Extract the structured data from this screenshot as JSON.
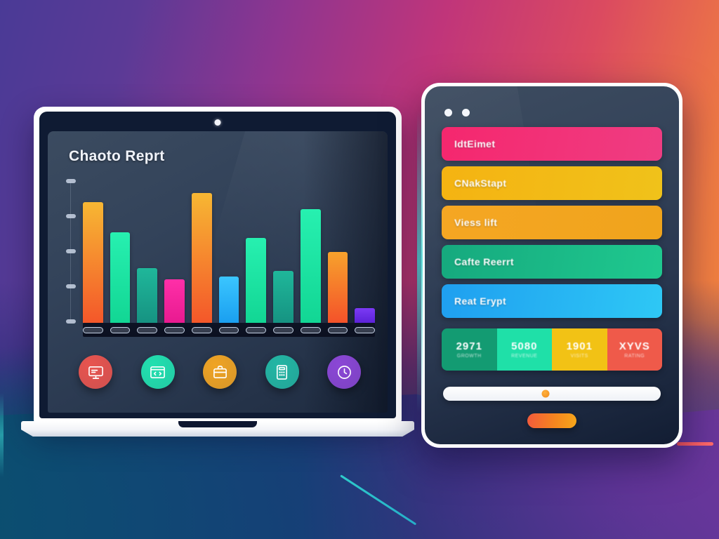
{
  "background": {
    "gradient_start": "#4a3a96",
    "gradient_mid": "#c0357a",
    "gradient_end": "#ee7a43",
    "bottom_teal": "#0b4e70",
    "accent_line": "#2fd8d2",
    "accent_dash": "#f4515a"
  },
  "laptop": {
    "screen_title": "Chaoto Reprt",
    "frame_color": "#ffffff",
    "screen_bg": "#33435a",
    "dock": [
      {
        "name": "presentation-icon",
        "color": "#e8544f",
        "glyph": "presentation"
      },
      {
        "name": "code-window-icon",
        "color": "#22e0b0",
        "glyph": "code"
      },
      {
        "name": "briefcase-icon",
        "color": "#f0a424",
        "glyph": "briefcase"
      },
      {
        "name": "calculator-icon",
        "color": "#23b6a4",
        "glyph": "calculator"
      },
      {
        "name": "clock-icon",
        "color": "#8b47d6",
        "glyph": "clock"
      }
    ]
  },
  "chart_data": {
    "type": "bar",
    "title": "Chaoto Reprt",
    "xlabel": "",
    "ylabel": "",
    "grid": false,
    "legend": "none",
    "ylim": [
      0,
      100
    ],
    "ytick_count": 5,
    "categories": [
      "",
      "",
      "",
      "",
      "",
      "",
      "",
      "",
      "",
      "",
      ""
    ],
    "values": [
      88,
      66,
      40,
      32,
      95,
      34,
      62,
      38,
      83,
      52,
      11
    ],
    "colors": [
      "#f5a623",
      "#1fe6a8",
      "#1aa98f",
      "#f0289c",
      "#f5a623",
      "#2bb6f0",
      "#1fe6a8",
      "#1aa98f",
      "#1fe6a8",
      "#f28c28",
      "#6b2ef0"
    ],
    "bar_gradients": [
      [
        "#f7b733",
        "#f4572a"
      ],
      [
        "#27f0b0",
        "#12d694"
      ],
      [
        "#1fb79a",
        "#169382"
      ],
      [
        "#ff2fa8",
        "#e81a90"
      ],
      [
        "#f7b733",
        "#f4572a"
      ],
      [
        "#3bc6ff",
        "#1a9ff0"
      ],
      [
        "#27f0b0",
        "#12d694"
      ],
      [
        "#1fb79a",
        "#169382"
      ],
      [
        "#27f0b0",
        "#12d694"
      ],
      [
        "#f7a22c",
        "#f4522a"
      ],
      [
        "#7b3af5",
        "#5c22d8"
      ]
    ]
  },
  "tablet": {
    "frame_color": "#ffffff",
    "window_dots": 2,
    "rows": [
      {
        "label": "IdtEimet",
        "color_start": "#f5276e",
        "color_end": "#ef3d82"
      },
      {
        "label": "CNakStapt",
        "color_start": "#f5b312",
        "color_end": "#f0c21a"
      },
      {
        "label": "Viess lift",
        "color_start": "#f5a623",
        "color_end": "#f0a41c"
      },
      {
        "label": "Cafte Reerrt",
        "color_start": "#16a97e",
        "color_end": "#1fc98f"
      },
      {
        "label": "Reat Erypt",
        "color_start": "#1f9ff0",
        "color_end": "#2ec8f5"
      }
    ],
    "tiles": [
      {
        "value": "2971",
        "label": "GROWTH",
        "color": "#139b72"
      },
      {
        "value": "5080",
        "label": "REVENUE",
        "color": "#1fe0a8"
      },
      {
        "value": "1901",
        "label": "VISITS",
        "color": "#f2c215"
      },
      {
        "value": "XYVS",
        "label": "RATING",
        "color": "#ef5a4a"
      }
    ],
    "slider": {
      "value_percent": 47,
      "knob_color": "#f09a1c",
      "track_color": "#ffffff"
    },
    "cta": {
      "label": "",
      "color_start": "#f25a3c",
      "color_end": "#f7a71a"
    }
  }
}
